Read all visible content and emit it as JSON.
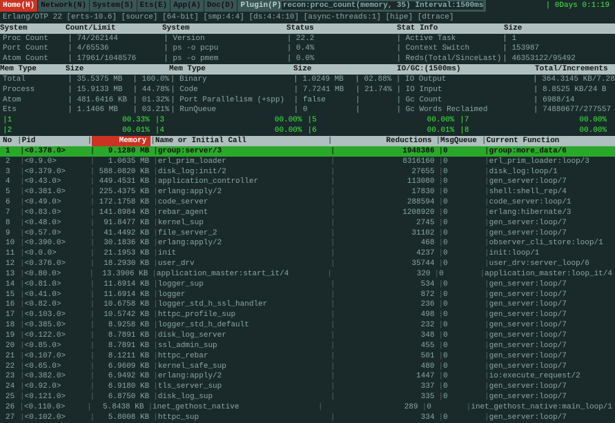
{
  "tabs": {
    "home": "Home(H)",
    "network": "Network(N)",
    "system": "System(S)",
    "ets": "Ets(E)",
    "app": "App(A)",
    "doc": "Doc(D)",
    "plugin": "Plugin(P)",
    "plugin_info": "recon:proc_count(memory, 35) Interval:1500ms",
    "uptime": "| 0Days 0:1:19"
  },
  "info_line": "Erlang/OTP 22 [erts-10.6] [source] [64-bit] [smp:4:4] [ds:4:4:10] [async-threads:1] [hipe] [dtrace]",
  "sys_hdr": [
    "System",
    "Count/Limit",
    "System",
    "Status",
    "Stat Info",
    "Size"
  ],
  "sys_rows": [
    [
      "Proc Count",
      "74/262144",
      "Version",
      "22.2",
      "Active Task",
      "1"
    ],
    [
      "Port Count",
      "4/65536",
      "ps -o pcpu",
      "0.4%",
      "Context Switch",
      "153987"
    ],
    [
      "Atom Count",
      "17961/1048576",
      "ps -o pmem",
      "0.0%",
      "Reds(Total/SinceLast)",
      "46353122/95492"
    ]
  ],
  "mem_hdr": [
    "Mem Type",
    "Size",
    "",
    "Mem Type",
    "Size",
    "",
    "IO/GC:(1500ms)",
    "Total/Increments"
  ],
  "mem_rows": [
    [
      "Total",
      "35.5375 MB",
      "100.0%",
      "Binary",
      "1.0249 MB",
      "02.88%",
      "IO Output",
      "364.3145 KB/7.2813 KB"
    ],
    [
      "Process",
      "15.9133 MB",
      "44.78%",
      "Code",
      "7.7241 MB",
      "21.74%",
      "IO Input",
      "8.8525 KB/24 B"
    ],
    [
      "Atom",
      "481.6416 KB",
      "01.32%",
      "Port Parallelism (+spp)",
      "false",
      "",
      "Gc Count",
      "6988/14"
    ],
    [
      "Ets",
      "1.1406 MB",
      "03.21%",
      "RunQueue",
      "0",
      "",
      "Gc Words Reclaimed",
      "74880677/277557"
    ]
  ],
  "queue_rows": [
    {
      "a": "|1",
      "av": "00.33%",
      "b": "|3",
      "bv": "00.00%",
      "c": "|5",
      "cv": "00.00%",
      "d": "|7",
      "dv": "00.00%"
    },
    {
      "a": "|2",
      "av": "00.01%",
      "b": "|4",
      "bv": "00.00%",
      "c": "|6",
      "cv": "00.01%",
      "d": "|8",
      "dv": "00.00%"
    }
  ],
  "proc_hdr": {
    "no": "No",
    "pid": "Pid",
    "mem": "Memory",
    "name": "Name or Initial Call",
    "red": "Reductions",
    "msg": "MsgQueue",
    "fn": "Current Function"
  },
  "procs": [
    {
      "no": "1",
      "pid": "<0.378.0>",
      "mem": "9.1280 MB",
      "name": "group:server/3",
      "red": "1948386",
      "msg": "0",
      "fn": "group:more_data/6",
      "hl": true
    },
    {
      "no": "2",
      "pid": "<0.9.0>",
      "mem": "1.0635 MB",
      "name": "erl_prim_loader",
      "red": "8316160",
      "msg": "0",
      "fn": "erl_prim_loader:loop/3"
    },
    {
      "no": "3",
      "pid": "<0.379.0>",
      "mem": "588.0820 KB",
      "name": "disk_log:init/2",
      "red": "27655",
      "msg": "0",
      "fn": "disk_log:loop/1"
    },
    {
      "no": "4",
      "pid": "<0.43.0>",
      "mem": "449.4531 KB",
      "name": "application_controller",
      "red": "113080",
      "msg": "0",
      "fn": "gen_server:loop/7"
    },
    {
      "no": "5",
      "pid": "<0.381.0>",
      "mem": "225.4375 KB",
      "name": "erlang:apply/2",
      "red": "17830",
      "msg": "0",
      "fn": "shell:shell_rep/4"
    },
    {
      "no": "6",
      "pid": "<0.49.0>",
      "mem": "172.1758 KB",
      "name": "code_server",
      "red": "288594",
      "msg": "0",
      "fn": "code_server:loop/1"
    },
    {
      "no": "7",
      "pid": "<0.83.0>",
      "mem": "141.8984 KB",
      "name": "rebar_agent",
      "red": "1208920",
      "msg": "0",
      "fn": "erlang:hibernate/3"
    },
    {
      "no": "8",
      "pid": "<0.48.0>",
      "mem": "91.8477 KB",
      "name": "kernel_sup",
      "red": "2745",
      "msg": "0",
      "fn": "gen_server:loop/7"
    },
    {
      "no": "9",
      "pid": "<0.57.0>",
      "mem": "41.4492 KB",
      "name": "file_server_2",
      "red": "31102",
      "msg": "0",
      "fn": "gen_server:loop/7"
    },
    {
      "no": "10",
      "pid": "<0.390.0>",
      "mem": "30.1836 KB",
      "name": "erlang:apply/2",
      "red": "468",
      "msg": "0",
      "fn": "observer_cli_store:loop/1"
    },
    {
      "no": "11",
      "pid": "<0.0.0>",
      "mem": "21.1953 KB",
      "name": "init",
      "red": "4237",
      "msg": "0",
      "fn": "init:loop/1"
    },
    {
      "no": "12",
      "pid": "<0.376.0>",
      "mem": "18.2930 KB",
      "name": "user_drv",
      "red": "35744",
      "msg": "0",
      "fn": "user_drv:server_loop/6"
    },
    {
      "no": "13",
      "pid": "<0.80.0>",
      "mem": "13.3906 KB",
      "name": "application_master:start_it/4",
      "red": "320",
      "msg": "0",
      "fn": "application_master:loop_it/4"
    },
    {
      "no": "14",
      "pid": "<0.81.0>",
      "mem": "11.6914 KB",
      "name": "logger_sup",
      "red": "534",
      "msg": "0",
      "fn": "gen_server:loop/7"
    },
    {
      "no": "15",
      "pid": "<0.41.0>",
      "mem": "11.6914 KB",
      "name": "logger",
      "red": "872",
      "msg": "0",
      "fn": "gen_server:loop/7"
    },
    {
      "no": "16",
      "pid": "<0.82.0>",
      "mem": "10.6758 KB",
      "name": "logger_std_h_ssl_handler",
      "red": "236",
      "msg": "0",
      "fn": "gen_server:loop/7"
    },
    {
      "no": "17",
      "pid": "<0.103.0>",
      "mem": "10.5742 KB",
      "name": "httpc_profile_sup",
      "red": "498",
      "msg": "0",
      "fn": "gen_server:loop/7"
    },
    {
      "no": "18",
      "pid": "<0.385.0>",
      "mem": "8.9258 KB",
      "name": "logger_std_h_default",
      "red": "232",
      "msg": "0",
      "fn": "gen_server:loop/7"
    },
    {
      "no": "19",
      "pid": "<0.122.0>",
      "mem": "8.7891 KB",
      "name": "disk_log_server",
      "red": "348",
      "msg": "0",
      "fn": "gen_server:loop/7"
    },
    {
      "no": "20",
      "pid": "<0.85.0>",
      "mem": "8.7891 KB",
      "name": "ssl_admin_sup",
      "red": "455",
      "msg": "0",
      "fn": "gen_server:loop/7"
    },
    {
      "no": "21",
      "pid": "<0.107.0>",
      "mem": "8.1211 KB",
      "name": "httpc_rebar",
      "red": "501",
      "msg": "0",
      "fn": "gen_server:loop/7"
    },
    {
      "no": "22",
      "pid": "<0.65.0>",
      "mem": "6.9609 KB",
      "name": "kernel_safe_sup",
      "red": "480",
      "msg": "0",
      "fn": "gen_server:loop/7"
    },
    {
      "no": "23",
      "pid": "<0.382.0>",
      "mem": "6.9492 KB",
      "name": "erlang:apply/2",
      "red": "1447",
      "msg": "0",
      "fn": "io:execute_request/2"
    },
    {
      "no": "24",
      "pid": "<0.92.0>",
      "mem": "6.9180 KB",
      "name": "tls_server_sup",
      "red": "337",
      "msg": "0",
      "fn": "gen_server:loop/7"
    },
    {
      "no": "25",
      "pid": "<0.121.0>",
      "mem": "6.8750 KB",
      "name": "disk_log_sup",
      "red": "335",
      "msg": "0",
      "fn": "gen_server:loop/7"
    },
    {
      "no": "26",
      "pid": "<0.110.0>",
      "mem": "5.8438 KB",
      "name": "inet_gethost_native",
      "red": "289",
      "msg": "0",
      "fn": "inet_gethost_native:main_loop/1"
    },
    {
      "no": "27",
      "pid": "<0.102.0>",
      "mem": "5.8008 KB",
      "name": "httpc_sup",
      "red": "334",
      "msg": "0",
      "fn": "gen_server:loop/7"
    }
  ]
}
